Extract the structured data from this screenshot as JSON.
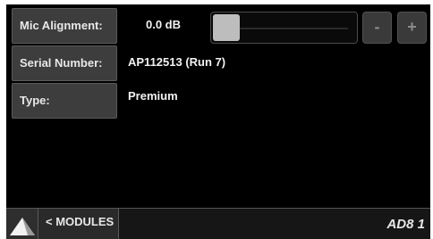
{
  "rows": {
    "mic_alignment": {
      "label": "Mic Alignment:",
      "value": "0.0 dB"
    },
    "serial_number": {
      "label": "Serial Number:",
      "value": "AP112513 (Run 7)"
    },
    "type": {
      "label": "Type:",
      "value": "Premium"
    }
  },
  "controls": {
    "decrement_label": "-",
    "increment_label": "+"
  },
  "footer": {
    "home_icon": "triangle-home-icon",
    "back_label": "< MODULES",
    "device_id": "AD8 1"
  }
}
